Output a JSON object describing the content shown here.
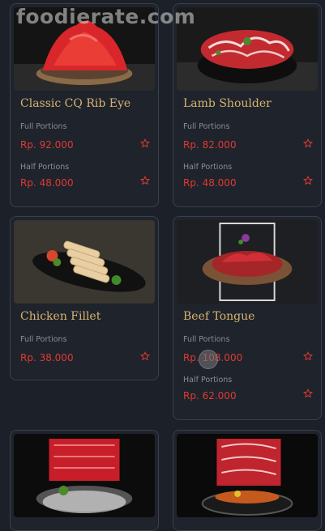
{
  "watermark": "foodierate.com",
  "colors": {
    "background": "#1c2029",
    "accent_price": "#e03a31",
    "title_gold": "#d8b46e"
  },
  "menu": {
    "items": [
      {
        "name": "Classic CQ Rib Eye",
        "portions": [
          {
            "label": "Full Portions",
            "price": "Rp. 92.000"
          },
          {
            "label": "Half Portions",
            "price": "Rp. 48.000"
          }
        ]
      },
      {
        "name": "Lamb Shoulder",
        "portions": [
          {
            "label": "Full Portions",
            "price": "Rp. 82.000"
          },
          {
            "label": "Half Portions",
            "price": "Rp. 48.000"
          }
        ]
      },
      {
        "name": "Chicken Fillet",
        "portions": [
          {
            "label": "Full Portions",
            "price": "Rp. 38.000"
          }
        ]
      },
      {
        "name": "Beef Tongue",
        "portions": [
          {
            "label": "Full Portions",
            "price": "Rp. 108.000"
          },
          {
            "label": "Half Portions",
            "price": "Rp. 62.000"
          }
        ]
      }
    ]
  },
  "icons": {
    "favorite": "star-outline-icon",
    "loading": "loading-spinner-icon"
  }
}
